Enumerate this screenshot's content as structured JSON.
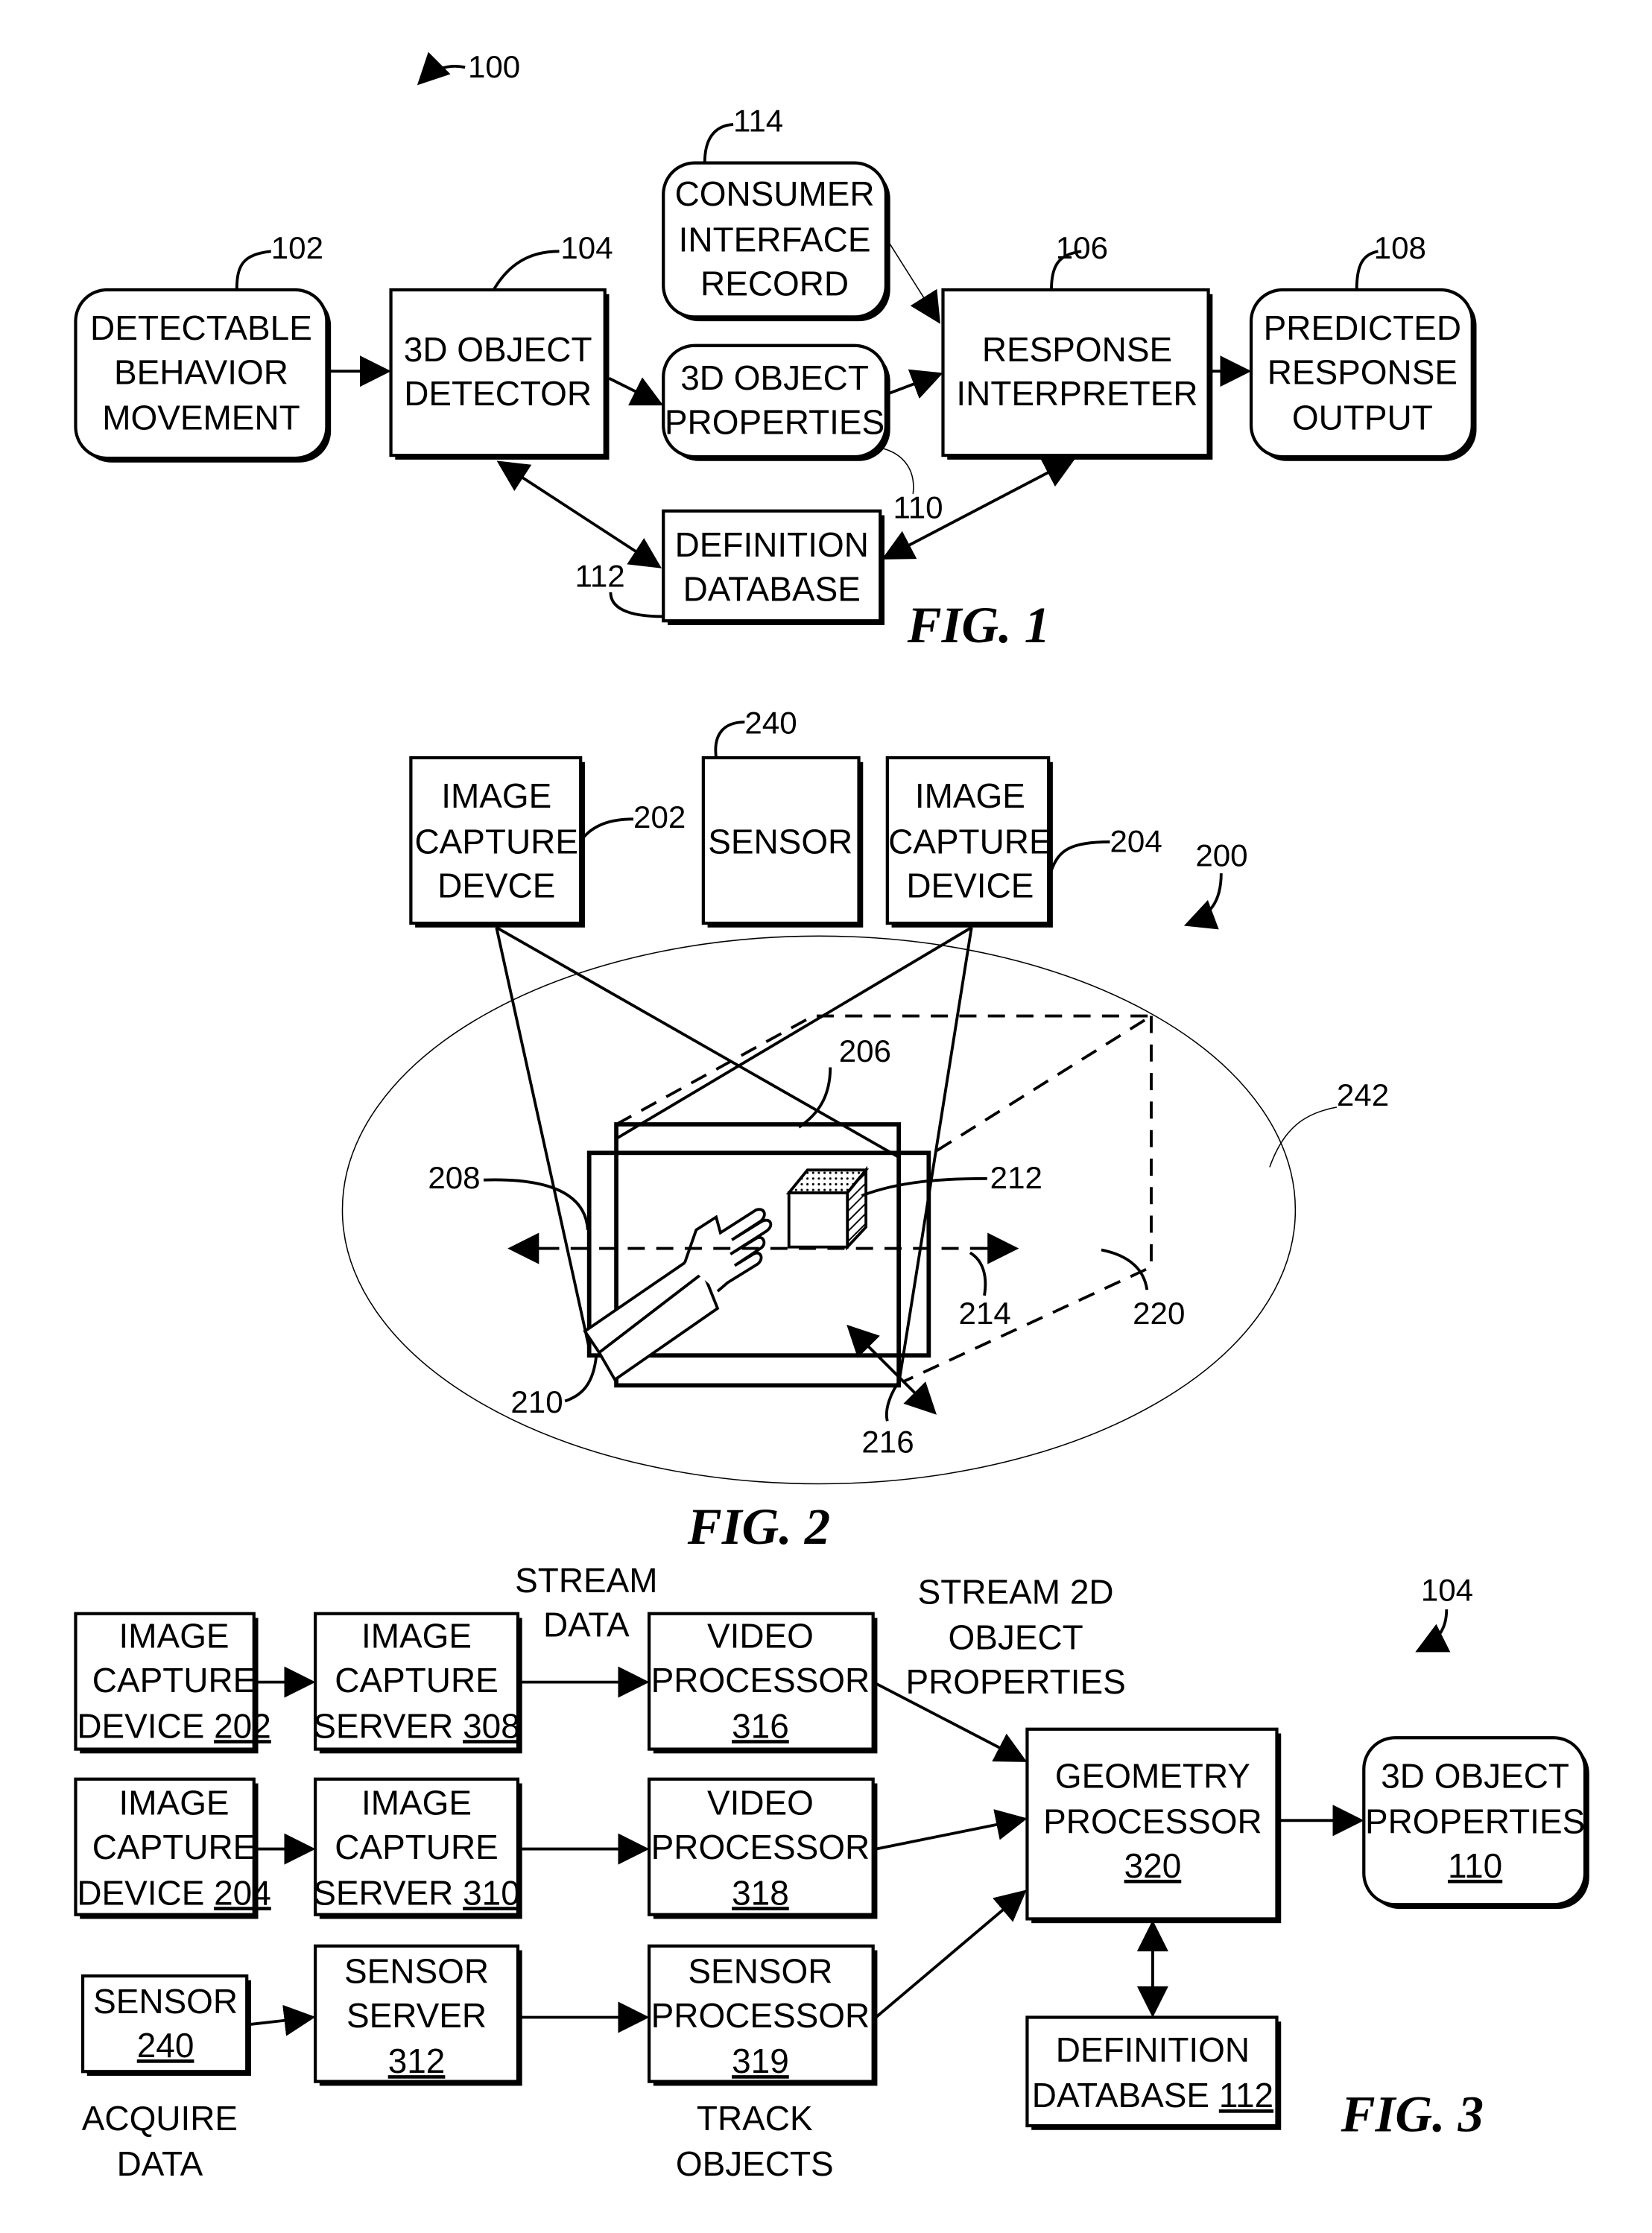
{
  "fig1": {
    "title": "FIG. 1",
    "ref": "100",
    "nodes": {
      "detectable": {
        "ref": "102",
        "lines": [
          "DETECTABLE",
          "BEHAVIOR",
          "MOVEMENT"
        ]
      },
      "detector": {
        "ref": "104",
        "lines": [
          "3D OBJECT",
          "DETECTOR"
        ]
      },
      "consumer": {
        "ref": "114",
        "lines": [
          "CONSUMER",
          "INTERFACE",
          "RECORD"
        ]
      },
      "properties": {
        "ref": "110",
        "lines": [
          "3D OBJECT",
          "PROPERTIES"
        ]
      },
      "interpreter": {
        "ref": "106",
        "lines": [
          "RESPONSE",
          "INTERPRETER"
        ]
      },
      "output": {
        "ref": "108",
        "lines": [
          "PREDICTED",
          "RESPONSE",
          "OUTPUT"
        ]
      },
      "database": {
        "ref": "112",
        "lines": [
          "DEFINITION",
          "DATABASE"
        ]
      }
    }
  },
  "fig2": {
    "title": "FIG. 2",
    "ref": "200",
    "nodes": {
      "cam1": {
        "ref": "202",
        "lines": [
          "IMAGE",
          "CAPTURE",
          "DEVCE"
        ]
      },
      "sensor": {
        "ref": "240",
        "lines": [
          "SENSOR"
        ]
      },
      "cam2": {
        "ref": "204",
        "lines": [
          "IMAGE",
          "CAPTURE",
          "DEVICE"
        ]
      }
    },
    "refs": {
      "plane": "206",
      "front_plane": "208",
      "hand": "210",
      "cube": "212",
      "x_axis": "214",
      "z_axis": "216",
      "volume": "220",
      "area": "242"
    }
  },
  "fig3": {
    "title": "FIG. 3",
    "ref": "104",
    "annotations": {
      "stream_data": [
        "STREAM",
        "DATA"
      ],
      "stream_2d": [
        "STREAM 2D",
        "OBJECT",
        "PROPERTIES"
      ],
      "acquire": [
        "ACQUIRE",
        "DATA"
      ],
      "track": [
        "TRACK",
        "OBJECTS"
      ]
    },
    "nodes": {
      "dev202": {
        "lines": [
          "IMAGE",
          "CAPTURE",
          "DEVICE "
        ],
        "num": "202"
      },
      "srv308": {
        "lines": [
          "IMAGE",
          "CAPTURE",
          "SERVER "
        ],
        "num": "308"
      },
      "vp316": {
        "lines": [
          "VIDEO",
          "PROCESSOR",
          ""
        ],
        "num": "316"
      },
      "dev204": {
        "lines": [
          "IMAGE",
          "CAPTURE",
          "DEVICE "
        ],
        "num": "204"
      },
      "srv310": {
        "lines": [
          "IMAGE",
          "CAPTURE",
          "SERVER "
        ],
        "num": "310"
      },
      "vp318": {
        "lines": [
          "VIDEO",
          "PROCESSOR",
          ""
        ],
        "num": "318"
      },
      "sensor240": {
        "lines": [
          "SENSOR",
          ""
        ],
        "num": "240"
      },
      "srv312": {
        "lines": [
          "SENSOR",
          "SERVER",
          ""
        ],
        "num": "312"
      },
      "sp319": {
        "lines": [
          "SENSOR",
          "PROCESSOR",
          ""
        ],
        "num": "319"
      },
      "geo320": {
        "lines": [
          "GEOMETRY",
          "PROCESSOR",
          ""
        ],
        "num": "320"
      },
      "prop110": {
        "lines": [
          "3D OBJECT",
          "PROPERTIES",
          ""
        ],
        "num": "110"
      },
      "db112": {
        "lines": [
          "DEFINITION",
          "DATABASE  "
        ],
        "num": "112"
      }
    }
  }
}
